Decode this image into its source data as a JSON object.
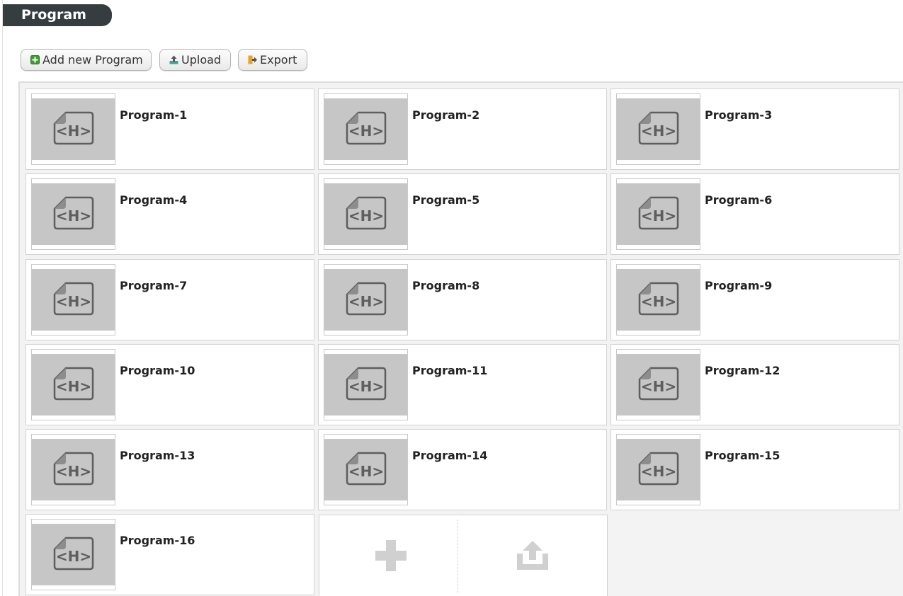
{
  "page": {
    "title": "Program"
  },
  "toolbar": {
    "add_label": "Add new Program",
    "upload_label": "Upload",
    "export_label": "Export",
    "add_icon": "plus-square-icon",
    "upload_icon": "upload-icon",
    "export_icon": "export-icon"
  },
  "programs": [
    {
      "name": "Program-1",
      "icon": "html-file-icon"
    },
    {
      "name": "Program-2",
      "icon": "html-file-icon"
    },
    {
      "name": "Program-3",
      "icon": "html-file-icon"
    },
    {
      "name": "Program-4",
      "icon": "html-file-icon"
    },
    {
      "name": "Program-5",
      "icon": "html-file-icon"
    },
    {
      "name": "Program-6",
      "icon": "html-file-icon"
    },
    {
      "name": "Program-7",
      "icon": "html-file-icon"
    },
    {
      "name": "Program-8",
      "icon": "html-file-icon"
    },
    {
      "name": "Program-9",
      "icon": "html-file-icon"
    },
    {
      "name": "Program-10",
      "icon": "html-file-icon"
    },
    {
      "name": "Program-11",
      "icon": "html-file-icon"
    },
    {
      "name": "Program-12",
      "icon": "html-file-icon"
    },
    {
      "name": "Program-13",
      "icon": "html-file-icon"
    },
    {
      "name": "Program-14",
      "icon": "html-file-icon"
    },
    {
      "name": "Program-15",
      "icon": "html-file-icon"
    },
    {
      "name": "Program-16",
      "icon": "html-file-icon"
    }
  ],
  "add_card": {
    "add_icon": "plus-icon",
    "upload_icon": "upload-tray-icon"
  },
  "colors": {
    "title_bg": "#363d40",
    "thumb_bg": "#c6c6c6",
    "panel_bg": "#f3f3f3",
    "add_green": "#3f9b2f",
    "upload_teal": "#3aa39b",
    "export_orange": "#f0a020"
  }
}
